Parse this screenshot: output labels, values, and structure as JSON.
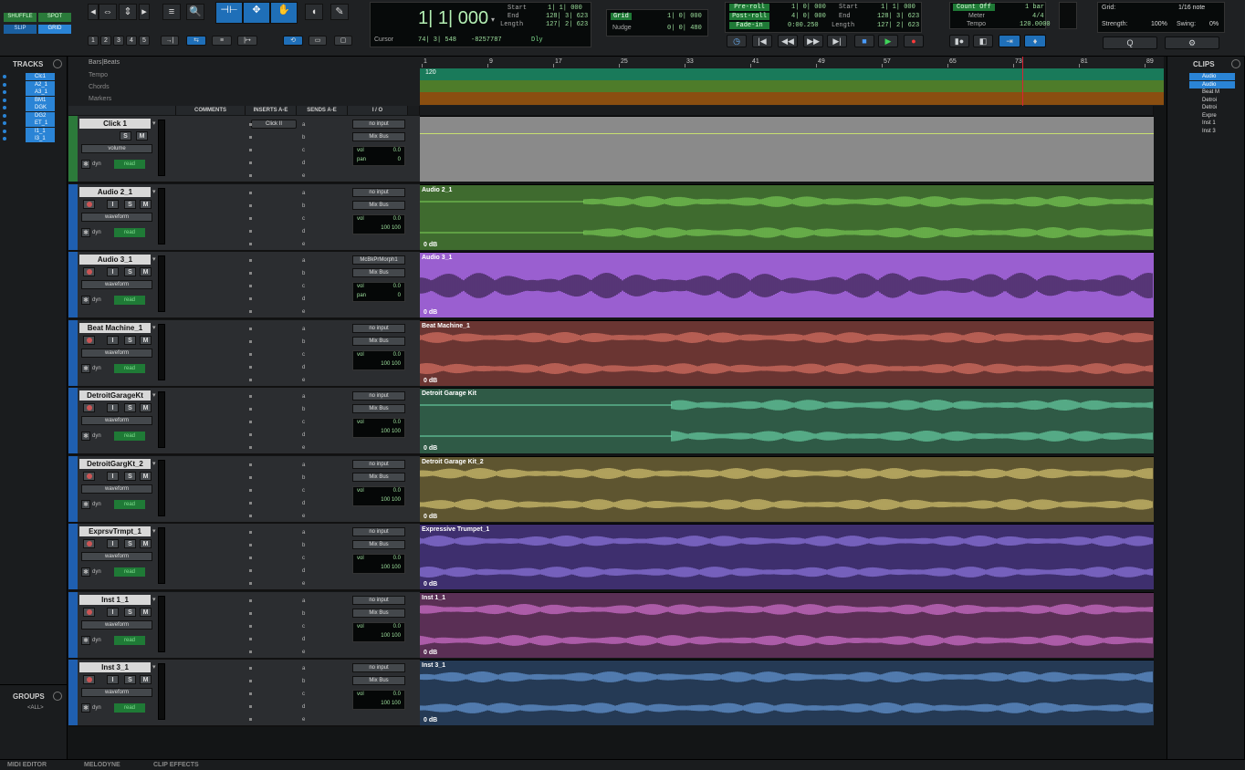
{
  "edit_modes": {
    "shuffle": "SHUFFLE",
    "spot": "SPOT",
    "slip": "SLIP",
    "grid": "GRID"
  },
  "zoom_presets": [
    "1",
    "2",
    "3",
    "4",
    "5"
  ],
  "counter": {
    "main": "1| 1| 000",
    "cursor_label": "Cursor",
    "cursor_value": "74| 3| 548",
    "sample_value": "-8257787",
    "dly": "Dly",
    "start_label": "Start",
    "end_label": "End",
    "length_label": "Length",
    "start": "1| 1| 000",
    "end": "128| 3| 623",
    "length": "127| 2| 623"
  },
  "grid": {
    "label": "Grid",
    "value": "1| 0| 000",
    "nudge_label": "Nudge",
    "nudge_value": "0| 0| 480"
  },
  "transport_readouts": {
    "preroll_label": "Pre-roll",
    "postroll_label": "Post-roll",
    "fadein_label": "Fade-in",
    "preroll": "1| 0| 000",
    "postroll": "4| 0| 000",
    "fadein": "0:00.250",
    "start_label": "Start",
    "end_label": "End",
    "length_label": "Length",
    "start": "1| 1| 000",
    "end": "128| 3| 623",
    "length": "127| 2| 623"
  },
  "meter_box": {
    "countoff": "Count Off",
    "countoff_value": "1 bar",
    "meter_label": "Meter",
    "meter": "4/4",
    "tempo_label": "Tempo",
    "tempo": "120.0000"
  },
  "grid_settings": {
    "grid_label": "Grid:",
    "grid_value": "1/16 note",
    "strength_label": "Strength:",
    "strength": "100%",
    "swing_label": "Swing:",
    "swing": "0%"
  },
  "tracks_panel": {
    "title": "TRACKS",
    "items": [
      "Clc1",
      "A2_1",
      "A3_1",
      "BM1",
      "DGK",
      "DG2",
      "ET_1",
      "I1_1",
      "I3_1"
    ]
  },
  "groups_panel": {
    "title": "GROUPS",
    "all": "<ALL>"
  },
  "clips_panel": {
    "title": "CLIPS",
    "items": [
      "Audio",
      "Audio",
      "Beat M",
      "Detroi",
      "Detroi",
      "Expre",
      "Inst 1",
      "Inst 3"
    ]
  },
  "rulers": {
    "bars": "Bars|Beats",
    "tempo": "Tempo",
    "chords": "Chords",
    "markers": "Markers",
    "tempo_marker": "120",
    "bars_ticks": [
      "1",
      "9",
      "17",
      "25",
      "33",
      "41",
      "49",
      "57",
      "65",
      "73",
      "81",
      "89"
    ]
  },
  "columns": {
    "comments": "COMMENTS",
    "inserts": "INSERTS A-E",
    "sends": "SENDS A-E",
    "io": "I / O"
  },
  "send_letters": [
    "a",
    "b",
    "c",
    "d",
    "e"
  ],
  "tracks": [
    {
      "name": "Click 1",
      "view": "volume",
      "input": "no input",
      "output": "Mix Bus",
      "vol": "0.0",
      "pan": "0",
      "insert": "Click II",
      "clip": "",
      "color": "#8a8a8a",
      "is_click": true
    },
    {
      "name": "Audio 2_1",
      "view": "waveform",
      "input": "no input",
      "output": "Mix Bus",
      "vol": "0.0",
      "pan": "100  100",
      "clip": "Audio 2_1",
      "gain": "0 dB",
      "color": "#3f6b2f",
      "wave": "#7fd65a"
    },
    {
      "name": "Audio 3_1",
      "view": "waveform",
      "input": "McBkPrMorph1",
      "output": "Mix Bus",
      "vol": "0.0",
      "pan": "0",
      "clip": "Audio 3_1",
      "gain": "0 dB",
      "color": "#9a5fd0",
      "wave": "#2a1a3a"
    },
    {
      "name": "Beat Machine_1",
      "view": "waveform",
      "input": "no input",
      "output": "Mix Bus",
      "vol": "0.0",
      "pan": "100  100",
      "clip": "Beat Machine_1",
      "gain": "0 dB",
      "color": "#6a3532",
      "wave": "#e87a6a"
    },
    {
      "name": "DetroitGarageKt",
      "view": "waveform",
      "input": "no input",
      "output": "Mix Bus",
      "vol": "0.0",
      "pan": "100  100",
      "clip": "Detroit Garage Kit",
      "gain": "0 dB",
      "color": "#2f5a46",
      "wave": "#6fe0b0"
    },
    {
      "name": "DetroitGargKt_2",
      "view": "waveform",
      "input": "no input",
      "output": "Mix Bus",
      "vol": "0.0",
      "pan": "100  100",
      "clip": "Detroit Garage Kit_2",
      "gain": "0 dB",
      "color": "#5e5530",
      "wave": "#e6d47a"
    },
    {
      "name": "ExprsvTrmpt_1",
      "view": "waveform",
      "input": "no input",
      "output": "Mix Bus",
      "vol": "0.0",
      "pan": "100  100",
      "clip": "Expressive Trumpet_1",
      "gain": "0 dB",
      "color": "#3e2f6e",
      "wave": "#9a82f0"
    },
    {
      "name": "Inst 1_1",
      "view": "waveform",
      "input": "no input",
      "output": "Mix Bus",
      "vol": "0.0",
      "pan": "100  100",
      "clip": "Inst 1_1",
      "gain": "0 dB",
      "color": "#5a2f55",
      "wave": "#e27adf"
    },
    {
      "name": "Inst 3_1",
      "view": "waveform",
      "input": "no input",
      "output": "Mix Bus",
      "vol": "0.0",
      "pan": "100  100",
      "clip": "Inst 3_1",
      "gain": "0 dB",
      "color": "#253a55",
      "wave": "#6fa6ea"
    }
  ],
  "labels": {
    "vol": "vol",
    "pan": "pan",
    "dyn": "dyn",
    "read": "read"
  },
  "bottom_tabs": [
    "MIDI EDITOR",
    "MELODYNE",
    "CLIP EFFECTS"
  ]
}
